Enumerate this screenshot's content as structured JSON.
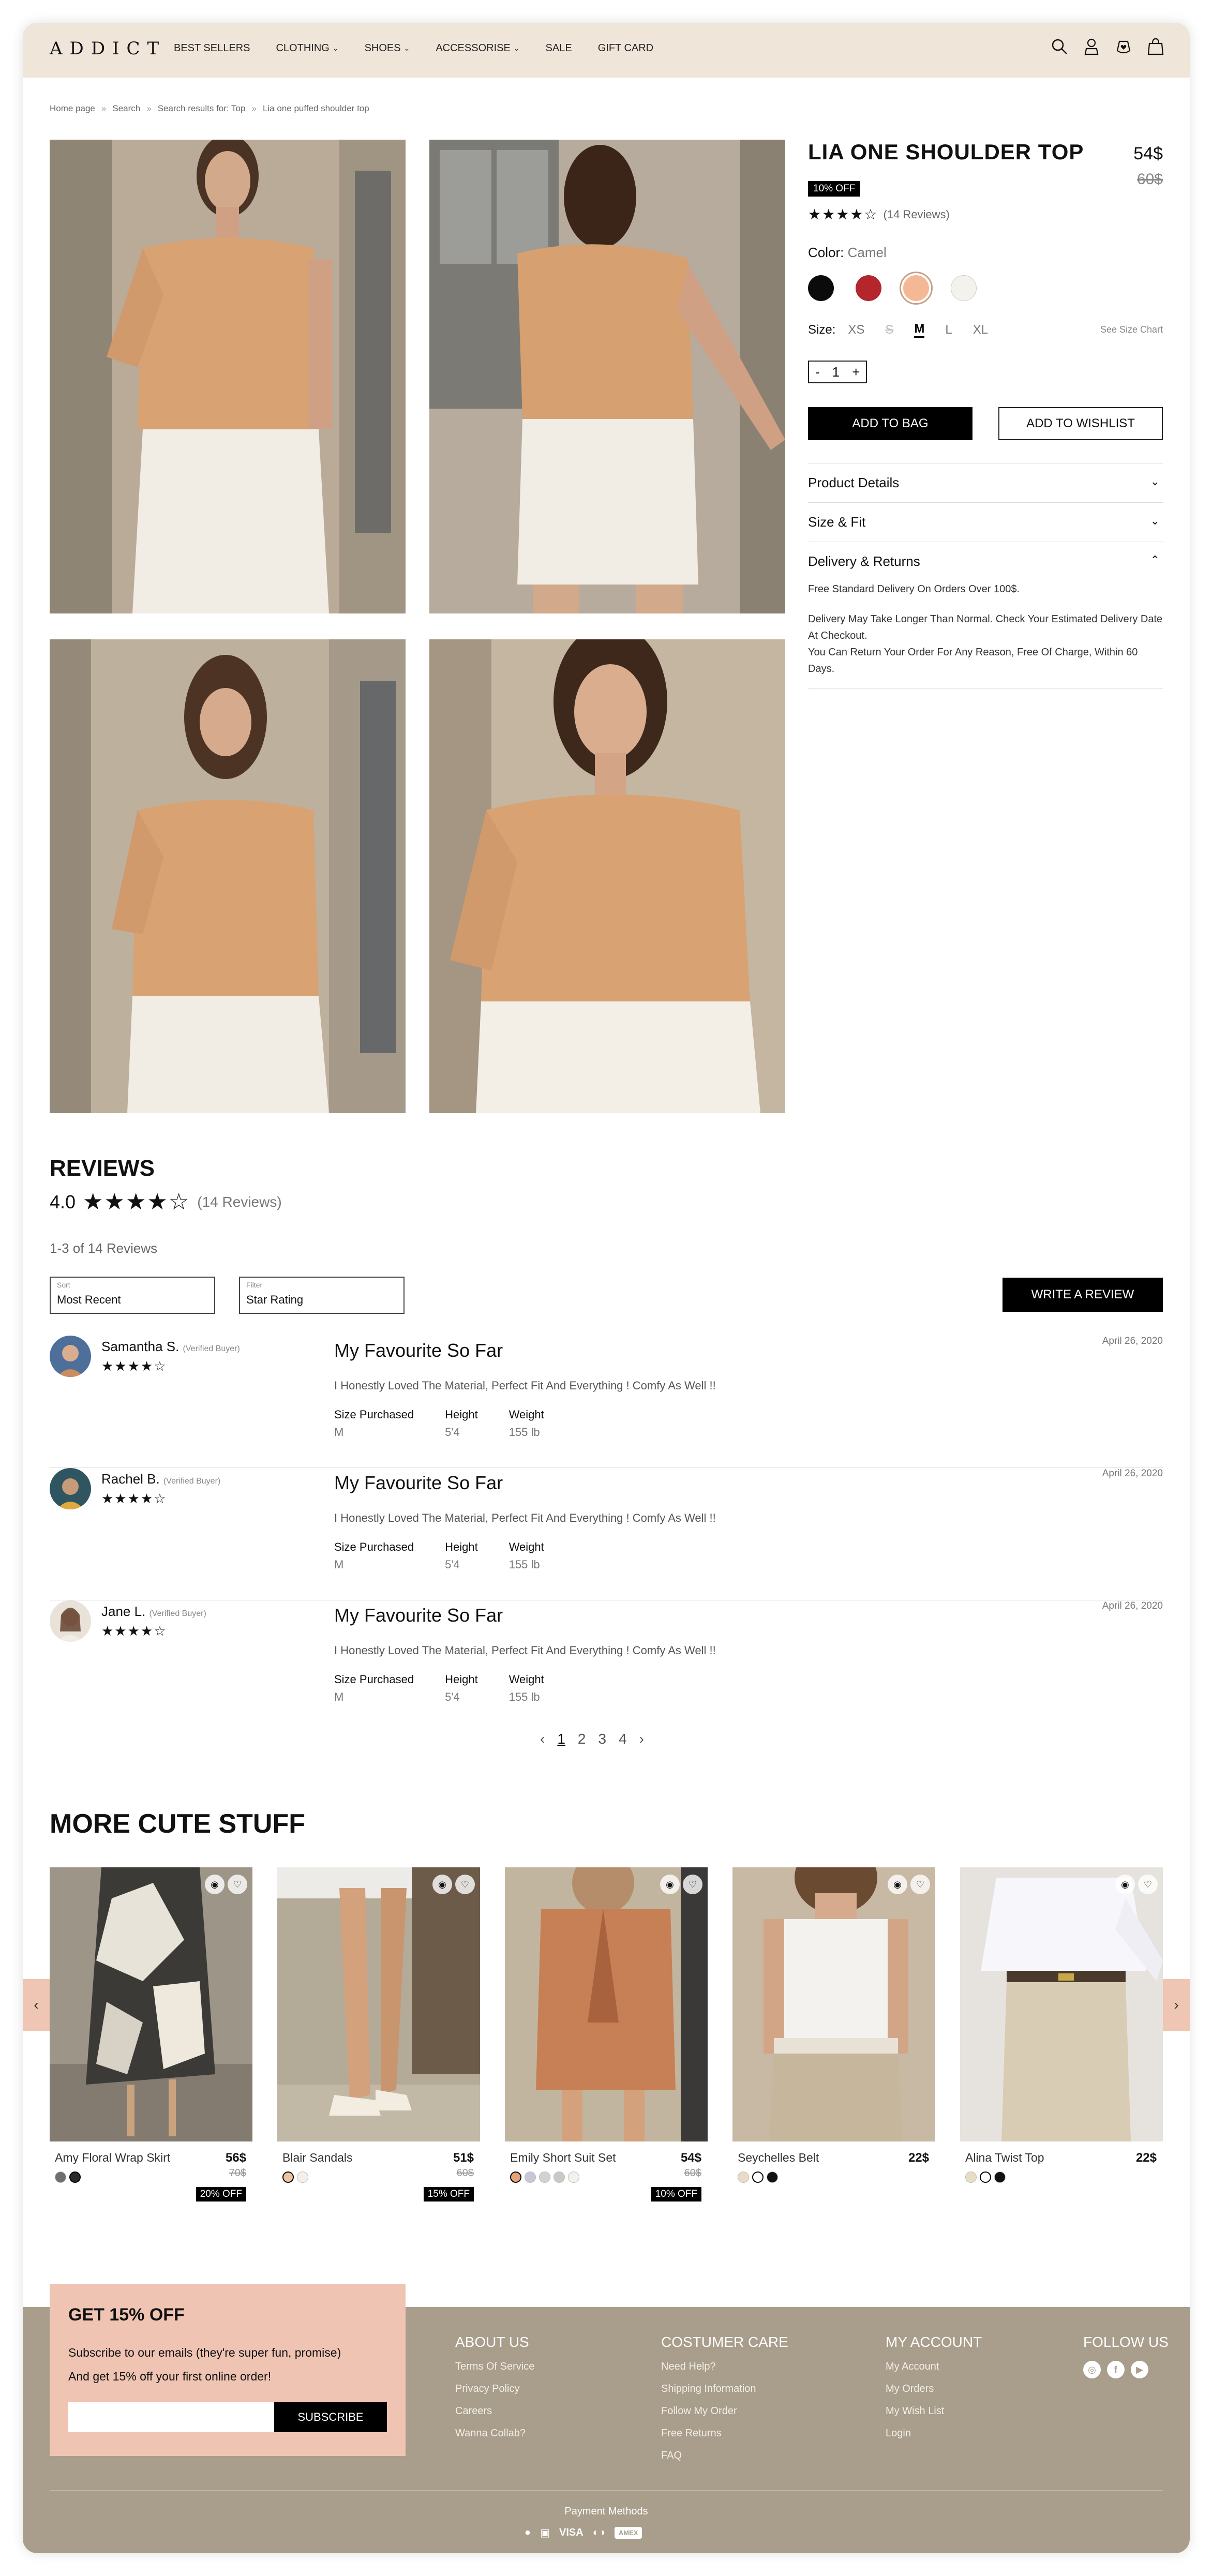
{
  "header": {
    "logo": "ADDICT",
    "nav": [
      {
        "label": "BEST SELLERS",
        "dropdown": false
      },
      {
        "label": "CLOTHING",
        "dropdown": true
      },
      {
        "label": "SHOES",
        "dropdown": true
      },
      {
        "label": "ACCESSORISE",
        "dropdown": true
      },
      {
        "label": "SALE",
        "dropdown": false
      },
      {
        "label": "GIFT CARD",
        "dropdown": false
      }
    ],
    "icons": [
      "search-icon",
      "user-icon",
      "wishlist-icon",
      "bag-icon"
    ]
  },
  "breadcrumb": [
    "Home page",
    "Search",
    "Search results for: Top",
    "Lia one puffed shoulder top"
  ],
  "product": {
    "title": "LIA ONE SHOULDER TOP",
    "price": "54$",
    "old_price": "60$",
    "discount": "10% OFF",
    "rating_stars": "★★★★☆",
    "reviews_count": "(14 Reviews)",
    "color_label": "Color:",
    "color_value": "Camel",
    "colors": [
      "#0b0b0b",
      "#b3262b",
      "#f5b895",
      "#f4f2ec"
    ],
    "selected_color_index": 2,
    "size_label": "Size:",
    "sizes": [
      "XS",
      "S",
      "M",
      "L",
      "XL"
    ],
    "selected_size": "M",
    "unavailable_size": "S",
    "size_chart": "See Size Chart",
    "qty_minus": "-",
    "qty": "1",
    "qty_plus": "+",
    "add_to_bag": "ADD TO BAG",
    "add_to_wishlist": "ADD TO WISHLIST",
    "accordion": [
      {
        "title": "Product Details",
        "open": false
      },
      {
        "title": "Size & Fit",
        "open": false
      },
      {
        "title": "Delivery & Returns",
        "open": true
      }
    ],
    "delivery_text_1": "Free Standard Delivery On Orders Over 100$.",
    "delivery_text_2": "Delivery May Take Longer Than Normal. Check Your Estimated Delivery Date At Checkout.",
    "delivery_text_3": "You Can Return Your Order For Any Reason, Free Of Charge, Within 60 Days."
  },
  "reviews": {
    "title": "REVIEWS",
    "average": "4.0",
    "stars": "★★★★☆",
    "count": "(14 Reviews)",
    "range": "1-3 of 14 Reviews",
    "sort_label": "Sort",
    "sort_value": "Most Recent",
    "filter_label": "Filter",
    "filter_value": "Star Rating",
    "write_button": "WRITE A REVIEW",
    "items": [
      {
        "name": "Samantha S.",
        "verified": "(Verified Buyer)",
        "stars": "★★★★☆",
        "headline": "My Favourite So Far",
        "date": "April 26, 2020",
        "text": "I Honestly Loved The Material, Perfect Fit And Everything ! Comfy As Well !!",
        "size_label": "Size Purchased",
        "size": "M",
        "height_label": "Height",
        "height": "5'4",
        "weight_label": "Weight",
        "weight": "155 lb"
      },
      {
        "name": "Rachel B.",
        "verified": "(Verified Buyer)",
        "stars": "★★★★☆",
        "headline": "My Favourite So Far",
        "date": "April 26, 2020",
        "text": "I Honestly Loved The Material, Perfect Fit And Everything ! Comfy As Well !!",
        "size_label": "Size Purchased",
        "size": "M",
        "height_label": "Height",
        "height": "5'4",
        "weight_label": "Weight",
        "weight": "155 lb"
      },
      {
        "name": "Jane L.",
        "verified": "(Verified Buyer)",
        "stars": "★★★★☆",
        "headline": "My Favourite So Far",
        "date": "April 26, 2020",
        "text": "I Honestly Loved The Material, Perfect Fit And Everything ! Comfy As Well !!",
        "size_label": "Size Purchased",
        "size": "M",
        "height_label": "Height",
        "height": "5'4",
        "weight_label": "Weight",
        "weight": "155 lb"
      }
    ],
    "pagination": {
      "prev": "‹",
      "pages": [
        "1",
        "2",
        "3",
        "4"
      ],
      "current": "1",
      "next": "›"
    }
  },
  "more": {
    "title": "MORE CUTE STUFF",
    "prev": "‹",
    "next": "›",
    "items": [
      {
        "name": "Amy Floral Wrap Skirt",
        "price": "56$",
        "old_price": "70$",
        "discount": "20% OFF",
        "swatches": [
          "#6f6f6f",
          "#2a2a2a"
        ]
      },
      {
        "name": "Blair Sandals",
        "price": "51$",
        "old_price": "60$",
        "discount": "15% OFF",
        "swatches": [
          "#f0c4a0",
          "#f3f0ea"
        ]
      },
      {
        "name": "Emily Short Suit Set",
        "price": "54$",
        "old_price": "60$",
        "discount": "10% OFF",
        "swatches": [
          "#e8a27a",
          "#c5c8d8",
          "#d2d2d2",
          "#c9c9c9",
          "#f3f1ec"
        ]
      },
      {
        "name": "Seychelles Belt",
        "price": "22$",
        "old_price": "",
        "discount": "",
        "swatches": [
          "#e7dcc6",
          "#ffffff",
          "#111111"
        ]
      },
      {
        "name": "Alina Twist Top",
        "price": "22$",
        "old_price": "",
        "discount": "",
        "swatches": [
          "#e7dcc6",
          "#ffffff",
          "#111111"
        ]
      }
    ]
  },
  "newsletter": {
    "title": "GET 15% OFF",
    "line1": "Subscribe to our emails (they're super fun, promise)",
    "line2": "And get 15% off your first online order!",
    "button": "SUBSCRIBE"
  },
  "footer": {
    "about": {
      "title": "ABOUT US",
      "links": [
        "Terms Of Service",
        "Privacy Policy",
        "Careers",
        "Wanna Collab?"
      ]
    },
    "care": {
      "title": "COSTUMER CARE",
      "links": [
        "Need Help?",
        "Shipping Information",
        "Follow My Order",
        "Free Returns",
        "FAQ"
      ]
    },
    "account": {
      "title": "MY ACCOUNT",
      "links": [
        "My Account",
        "My Orders",
        "My Wish List",
        "Login"
      ]
    },
    "follow": {
      "title": "FOLLOW US",
      "icons": [
        "instagram-icon",
        "facebook-icon",
        "youtube-icon"
      ]
    },
    "payment_label": "Payment Methods",
    "payment_brands": [
      "VISA",
      "AMEX"
    ]
  }
}
